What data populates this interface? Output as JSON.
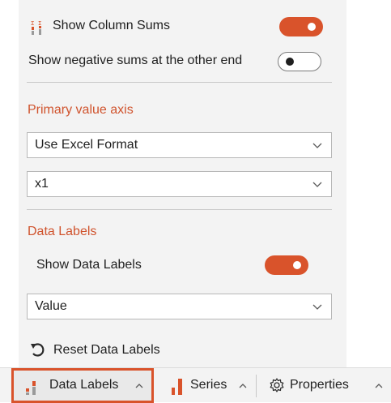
{
  "column_sums": {
    "label": "Show Column Sums",
    "icon": "column-sums-icon",
    "toggle_on": true
  },
  "negative_sums": {
    "label": "Show negative sums at the other end",
    "toggle_on": false
  },
  "primary_axis": {
    "title": "Primary value axis",
    "format_value": "Use Excel Format",
    "scale_value": "x1"
  },
  "data_labels": {
    "title": "Data Labels",
    "show_label": "Show Data Labels",
    "toggle_on": true,
    "content_value": "Value",
    "reset_label": "Reset Data Labels"
  },
  "bottom_tabs": [
    {
      "label": "Data Labels",
      "icon": "data-labels-icon",
      "active": true
    },
    {
      "label": "Series",
      "icon": "series-bar-icon",
      "active": false
    },
    {
      "label": "Properties",
      "icon": "gear-icon",
      "active": false
    }
  ],
  "colors": {
    "accent": "#d9532b",
    "section_title": "#d0532d",
    "panel_bg": "#f3f3f3"
  }
}
